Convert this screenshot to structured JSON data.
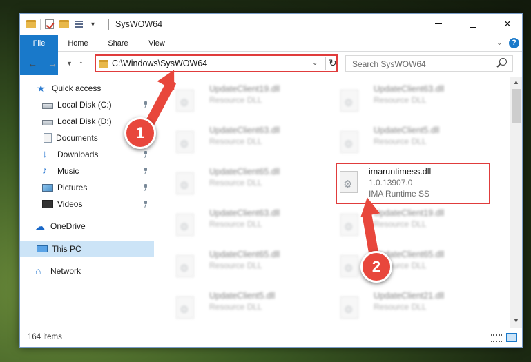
{
  "window": {
    "title": "SysWOW64"
  },
  "ribbon": {
    "tabs": [
      "File",
      "Home",
      "Share",
      "View"
    ],
    "help": "?"
  },
  "nav": {
    "address": "C:\\Windows\\SysWOW64",
    "search_placeholder": "Search SysWOW64"
  },
  "sidebar": {
    "items": [
      {
        "label": "Quick access",
        "icon": "star-icon"
      },
      {
        "label": "Local Disk (C:)",
        "icon": "disk-icon"
      },
      {
        "label": "Local Disk (D:)",
        "icon": "disk-icon"
      },
      {
        "label": "Documents",
        "icon": "documents-icon"
      },
      {
        "label": "Downloads",
        "icon": "downloads-icon"
      },
      {
        "label": "Music",
        "icon": "music-icon"
      },
      {
        "label": "Pictures",
        "icon": "pictures-icon"
      },
      {
        "label": "Videos",
        "icon": "videos-icon"
      },
      {
        "label": "OneDrive",
        "icon": "cloud-icon"
      },
      {
        "label": "This PC",
        "icon": "pc-icon"
      },
      {
        "label": "Network",
        "icon": "network-icon"
      }
    ]
  },
  "files": [
    {
      "name": "UpdateClient19.dll",
      "desc": "Resource DLL"
    },
    {
      "name": "UpdateClient63.dll",
      "desc": "Resource DLL"
    },
    {
      "name": "UpdateClient63.dll",
      "desc": "Resource DLL"
    },
    {
      "name": "UpdateClient5.dll",
      "desc": "Resource DLL"
    },
    {
      "name": "UpdateClient65.dll",
      "desc": "Resource DLL"
    },
    {
      "name": "imaruntimess.dll",
      "version": "1.0.13907.0",
      "desc": "IMA Runtime SS"
    },
    {
      "name": "UpdateClient63.dll",
      "desc": "Resource DLL"
    },
    {
      "name": "UpdateClient19.dll",
      "desc": "Resource DLL"
    },
    {
      "name": "UpdateClient65.dll",
      "desc": "Resource DLL"
    },
    {
      "name": "UpdateClient65.dll",
      "desc": "Resource DLL"
    },
    {
      "name": "UpdateClient5.dll",
      "desc": "Resource DLL"
    },
    {
      "name": "UpdateClient21.dll",
      "desc": "Resource DLL"
    }
  ],
  "status": {
    "count": "164 items"
  },
  "annotations": {
    "step1": "1",
    "step2": "2"
  },
  "colors": {
    "accent": "#1979ca",
    "highlight": "#e03c3c",
    "arrow": "#e8473c"
  }
}
